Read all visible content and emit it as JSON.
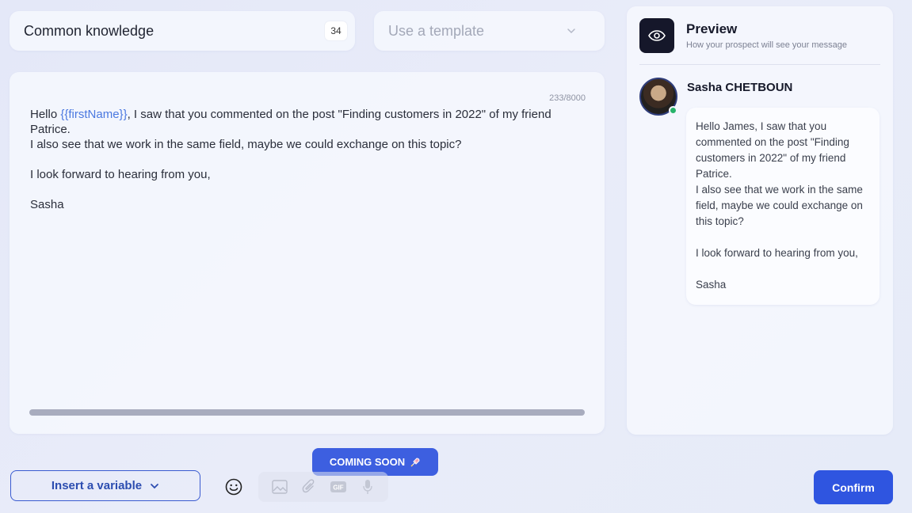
{
  "title_field": {
    "value": "Common knowledge",
    "count": "34"
  },
  "template_select": {
    "placeholder": "Use a template",
    "icon": "chevron-down-icon"
  },
  "editor": {
    "char_count": "233/8000",
    "line1_pre": "Hello ",
    "variable": "{{firstName}}",
    "line1_post": ", I saw that you commented on the post \"Finding customers in 2022\" of my friend Patrice.",
    "line2": "I also see that we work in the same field, maybe we could exchange on this topic?",
    "line3": "I look forward to hearing from you,",
    "signature": "Sasha"
  },
  "preview": {
    "icon": "eye-icon",
    "title": "Preview",
    "subtitle": "How your prospect will see your message",
    "prospect_name": "Sasha CHETBOUN",
    "bubble": {
      "p1": "Hello James, I saw that you commented on the post \"Finding customers in 2022\" of my friend Patrice.",
      "p2": "I also see that we work in the same field, maybe we could exchange on this topic?",
      "p3": "I look forward to hearing from you,",
      "p4": "Sasha"
    }
  },
  "toolbar": {
    "coming_soon": "COMING SOON",
    "insert_variable": "Insert a variable",
    "confirm": "Confirm"
  },
  "colors": {
    "accent": "#2f55e0",
    "variable": "#4a78e0",
    "online": "#27b36a",
    "dark": "#15172a"
  }
}
